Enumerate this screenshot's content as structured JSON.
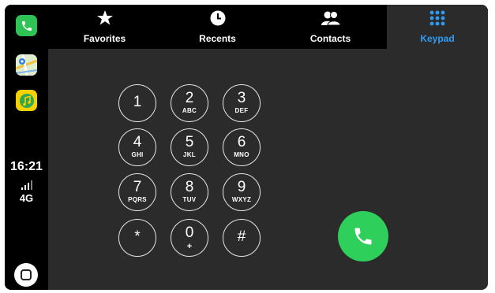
{
  "rail": {
    "apps": [
      {
        "name": "phone",
        "icon": "phone-icon",
        "color": "#2fc254"
      },
      {
        "name": "maps",
        "icon": "maps-icon",
        "color": "#e9f1e0"
      },
      {
        "name": "music",
        "icon": "music-icon",
        "color": "#f7d000"
      }
    ],
    "status": {
      "time": "16:21",
      "network": "4G",
      "signal_bars": 4
    },
    "home_icon": "home-button-icon"
  },
  "tabs": [
    {
      "label": "Favorites",
      "icon": "star-icon",
      "active": false
    },
    {
      "label": "Recents",
      "icon": "clock-icon",
      "active": false
    },
    {
      "label": "Contacts",
      "icon": "contacts-icon",
      "active": false
    },
    {
      "label": "Keypad",
      "icon": "keypad-grid-icon",
      "active": true
    }
  ],
  "keypad": {
    "keys": [
      {
        "digit": "1",
        "letters": ""
      },
      {
        "digit": "2",
        "letters": "ABC"
      },
      {
        "digit": "3",
        "letters": "DEF"
      },
      {
        "digit": "4",
        "letters": "GHI"
      },
      {
        "digit": "5",
        "letters": "JKL"
      },
      {
        "digit": "6",
        "letters": "MNO"
      },
      {
        "digit": "7",
        "letters": "PQRS"
      },
      {
        "digit": "8",
        "letters": "TUV"
      },
      {
        "digit": "9",
        "letters": "WXYZ"
      },
      {
        "digit": "*",
        "letters": ""
      },
      {
        "digit": "0",
        "letters": "+"
      },
      {
        "digit": "#",
        "letters": ""
      }
    ],
    "call_icon": "phone-call-icon"
  },
  "colors": {
    "accent": "#2f9cf4",
    "call_green": "#2fcf5b",
    "background": "#2b2b2b",
    "bar": "#000000"
  }
}
